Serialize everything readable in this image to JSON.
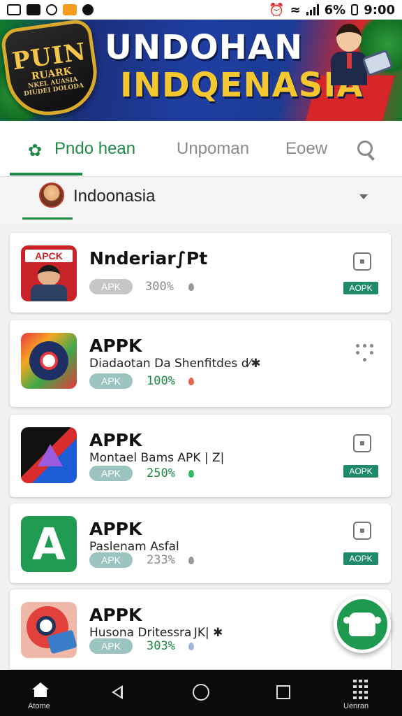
{
  "status_bar": {
    "battery": "6%",
    "time": "9:00"
  },
  "banner": {
    "badge_line1": "PUIN",
    "badge_line2": "RUARK",
    "badge_line3": "NKEL AUASIA",
    "badge_line4": "DIUDEI DOLODA",
    "title_line1": "UNDOHAN",
    "title_line2": "INDQENASIA"
  },
  "tabs": [
    {
      "label": "Pndo hean",
      "active": true
    },
    {
      "label": "Unpoman",
      "active": false
    },
    {
      "label": "Eoew",
      "active": false
    }
  ],
  "region": {
    "label": "Indoonasia"
  },
  "apps": [
    {
      "icon_text": "APCK",
      "title": "Nnderiar∫Pt",
      "subtitle": "",
      "pill": "APK",
      "percent": "300%",
      "ribbon": "AOPK"
    },
    {
      "title": "APPK",
      "subtitle": "Diadaotan Da Shenfitdes d⁄✱",
      "pill": "APK",
      "percent": "100%",
      "ribbon": ""
    },
    {
      "title": "APPK",
      "subtitle": "Montael Bams APK | Z|",
      "pill": "APK",
      "percent": "250%",
      "ribbon": "AOPK"
    },
    {
      "title": "APPK",
      "subtitle": "Paslenam Asfal",
      "pill": "APK",
      "percent": "233%",
      "ribbon": "AOPK"
    },
    {
      "title": "APPK",
      "subtitle": "Husona Dritessra JK| ✱",
      "pill": "APK",
      "percent": "303%",
      "ribbon": ""
    }
  ],
  "navbar": {
    "home_label": "Atome",
    "menu_label": "Uenran"
  },
  "colors": {
    "accent": "#1e8a45",
    "banner_blue": "#1f3ea1",
    "banner_gold": "#f4c731",
    "ribbon": "#1e8a6a"
  }
}
